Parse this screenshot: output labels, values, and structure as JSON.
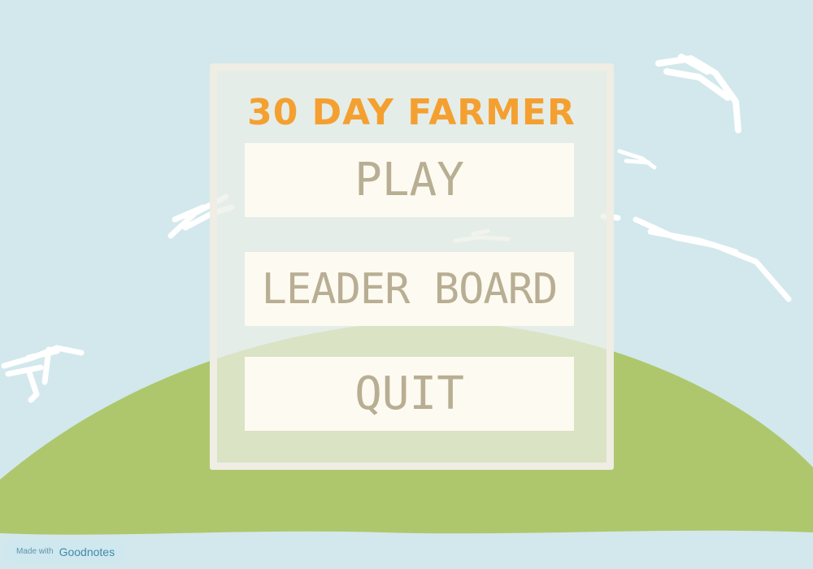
{
  "game": {
    "title": "30 DAY FARMER",
    "menu": {
      "play_label": "PLAY",
      "leaderboard_label": "LEADER BOARD",
      "quit_label": "QUIT"
    }
  },
  "watermark": {
    "prefix": "Made with",
    "brand": "Goodnotes"
  },
  "colors": {
    "sky": "#D2E8EC",
    "hill": "#AEC76D",
    "cloud": "#FFFFFF",
    "title": "#F4A031",
    "button_bg": "#FDFAF1",
    "button_text": "#B8AE93",
    "panel_border": "#EFEDE4"
  }
}
